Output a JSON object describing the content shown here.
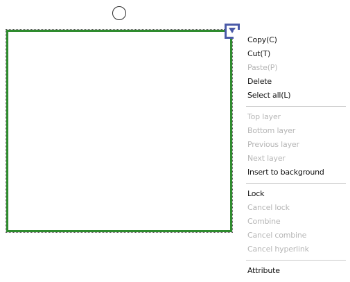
{
  "context_menu": {
    "groups": [
      {
        "items": [
          {
            "label": "Copy(C)",
            "enabled": true
          },
          {
            "label": "Cut(T)",
            "enabled": true
          },
          {
            "label": "Paste(P)",
            "enabled": false
          },
          {
            "label": "Delete",
            "enabled": true
          },
          {
            "label": "Select all(L)",
            "enabled": true
          }
        ]
      },
      {
        "items": [
          {
            "label": "Top layer",
            "enabled": false
          },
          {
            "label": "Bottom layer",
            "enabled": false
          },
          {
            "label": "Previous layer",
            "enabled": false
          },
          {
            "label": "Next layer",
            "enabled": false
          },
          {
            "label": "Insert to background",
            "enabled": true
          }
        ]
      },
      {
        "items": [
          {
            "label": "Lock",
            "enabled": true
          },
          {
            "label": "Cancel lock",
            "enabled": false
          },
          {
            "label": "Combine",
            "enabled": false
          },
          {
            "label": "Cancel combine",
            "enabled": false
          },
          {
            "label": "Cancel hyperlink",
            "enabled": false
          }
        ]
      },
      {
        "items": [
          {
            "label": "Attribute",
            "enabled": true
          }
        ]
      }
    ]
  },
  "colors": {
    "shape_border": "#2e8b2e",
    "handle": "#4a5aa8",
    "disabled_text": "#b6b6b6"
  }
}
